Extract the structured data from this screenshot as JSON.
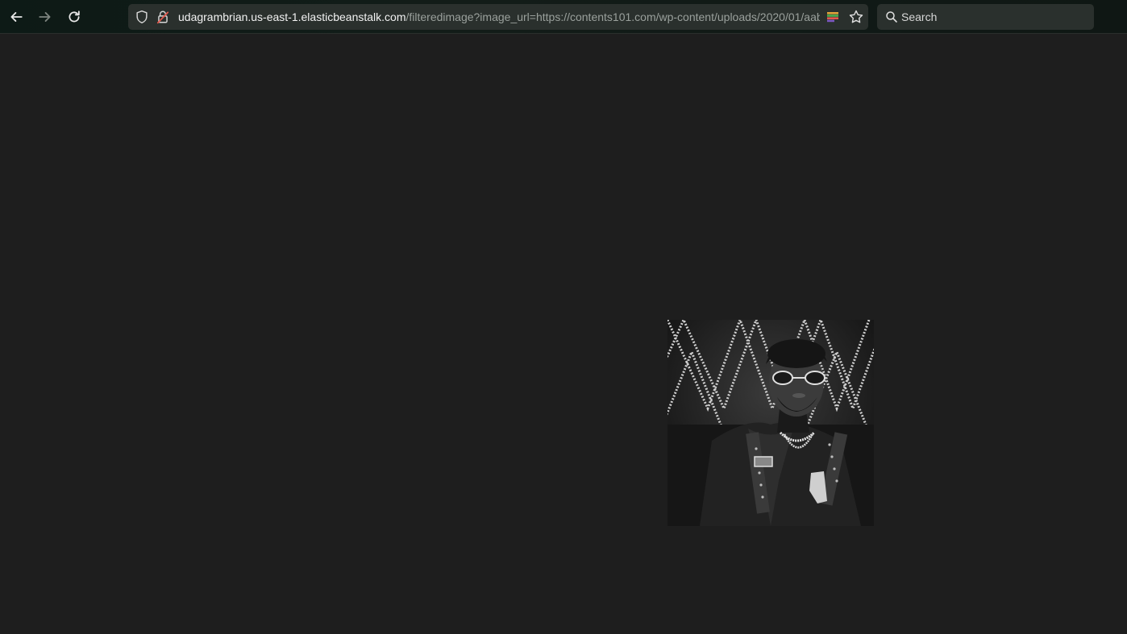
{
  "browser": {
    "url": {
      "host": "udagrambrian.us-east-1.elasticbeanstalk.com",
      "path": "/filteredimage?image_url=https://contents101.com/wp-content/uploads/2020/01/aab"
    },
    "search": {
      "placeholder": "Search"
    }
  },
  "icons": {
    "back": "arrow-left-icon",
    "forward": "arrow-right-icon",
    "reload": "reload-icon",
    "shield": "shield-icon",
    "lock": "insecure-lock-icon",
    "extension": "color-extension-icon",
    "star": "star-icon",
    "search": "search-icon"
  },
  "colors": {
    "page_background": "#1e1e1e",
    "toolbar": "#0f1a16",
    "urlbar": "#2a302d"
  },
  "page": {
    "image": {
      "description": "grayscale filtered photo"
    }
  }
}
